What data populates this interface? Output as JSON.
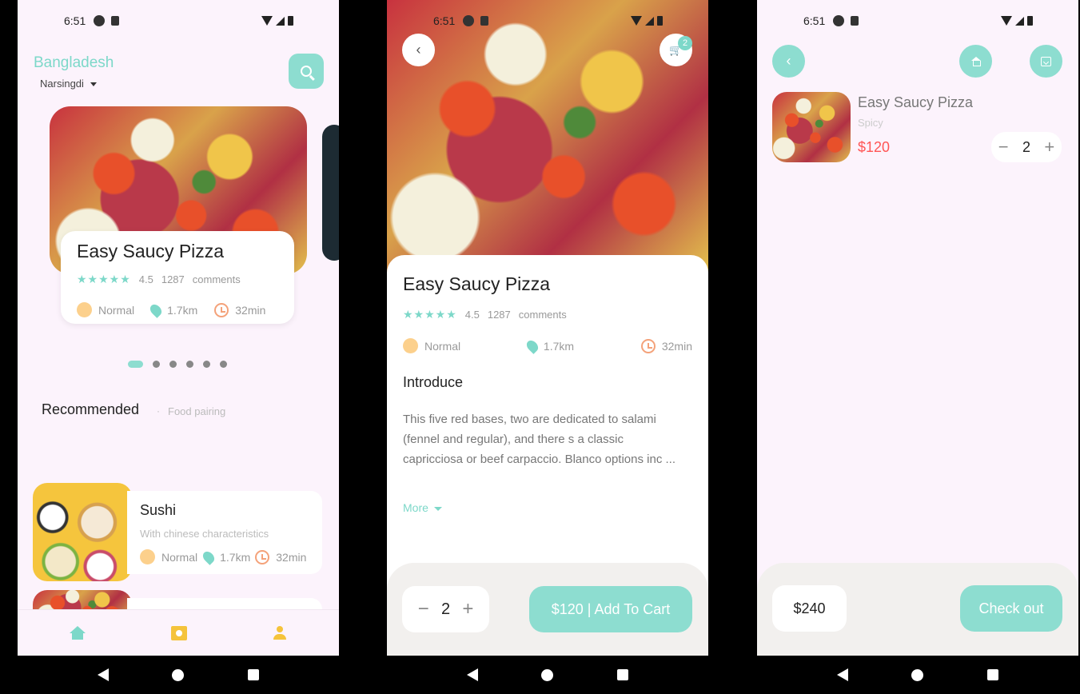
{
  "status": {
    "time": "6:51"
  },
  "home": {
    "country": "Bangladesh",
    "city": "Narsingdi",
    "featured": {
      "title": "Easy Saucy Pizza",
      "stars": "★★★★★",
      "rating": "4.5",
      "comments_count": "1287",
      "comments_label": "comments",
      "level": "Normal",
      "distance": "1.7km",
      "time": "32min"
    },
    "carousel": {
      "pages": 6,
      "active": 0
    },
    "recommended_title": "Recommended",
    "recommended_sep": "·",
    "recommended_sub": "Food pairing",
    "recommended_items": [
      {
        "name": "Sushi",
        "desc": "With chinese characteristics",
        "level": "Normal",
        "distance": "1.7km",
        "time": "32min"
      }
    ]
  },
  "detail": {
    "cart_count": "2",
    "title": "Easy Saucy Pizza",
    "stars": "★★★★★",
    "rating": "4.5",
    "comments_count": "1287",
    "comments_label": "comments",
    "level": "Normal",
    "distance": "1.7km",
    "time": "32min",
    "intro_title": "Introduce",
    "intro_text": "This five red bases, two are dedicated to salami (fennel and regular), and there s a classic capricciosa or beef carpaccio. Blanco options inc ...",
    "more_label": "More",
    "quantity": "2",
    "add_to_cart_label": "$120 | Add To Cart"
  },
  "cart": {
    "item": {
      "name": "Easy Saucy Pizza",
      "flavor": "Spicy",
      "price": "$120",
      "quantity": "2"
    },
    "total": "$240",
    "checkout_label": "Check out"
  },
  "colors": {
    "accent": "#8dddd0",
    "accent_text": "#7dd8c9",
    "price": "#ff5555",
    "warm": "#f5c33b",
    "background": "#fcf3fc"
  },
  "icons": {
    "minus": "−",
    "plus": "+",
    "back": "‹",
    "cart": "🛒"
  }
}
